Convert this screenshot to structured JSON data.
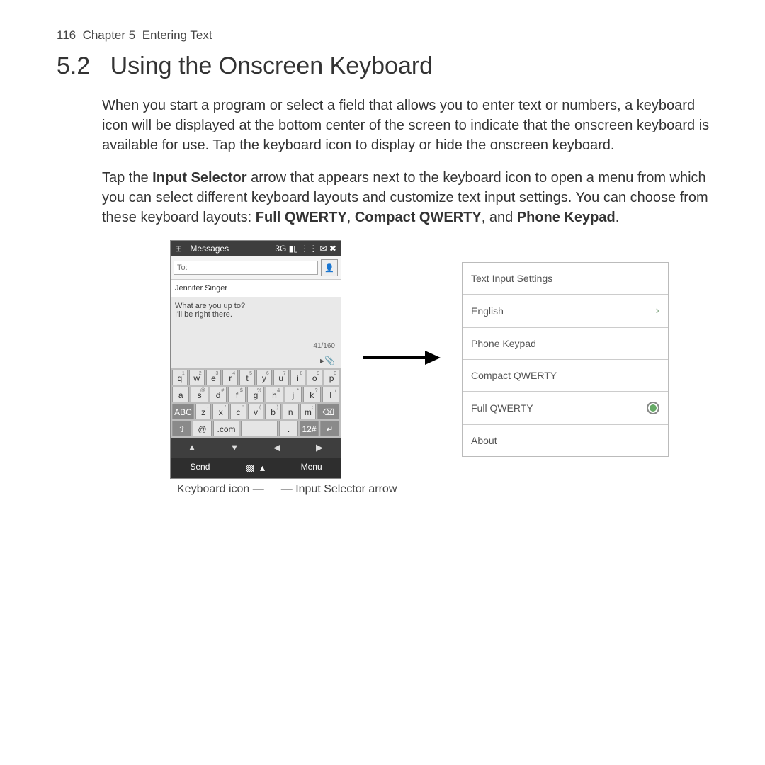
{
  "header": {
    "page_number": "116",
    "chapter": "Chapter 5",
    "chapter_title": "Entering Text"
  },
  "section": {
    "number": "5.2",
    "title": "Using the Onscreen Keyboard"
  },
  "paragraphs": {
    "p1": "When you start a program or select a field that allows you to enter text or numbers, a keyboard icon will be displayed at the bottom center of the screen to indicate that the onscreen keyboard is available for use. Tap the keyboard icon to display or hide the onscreen keyboard.",
    "p2a": "Tap the ",
    "p2b": "Input Selector",
    "p2c": " arrow that appears next to the keyboard icon to open a menu from which you can select different keyboard layouts and customize text input settings. You can choose from these keyboard layouts: ",
    "p2d": "Full QWERTY",
    "p2e": ", ",
    "p2f": "Compact QWERTY",
    "p2g": ", and ",
    "p2h": "Phone Keypad",
    "p2i": "."
  },
  "phone": {
    "app_title": "Messages",
    "status_icons": "3G ▮▯ ⋮⋮ ✉ ✖",
    "to_placeholder": "To:",
    "contact_name": "Jennifer Singer",
    "message_text": "What are you up to?\nI'll be right there.",
    "counter": "41/160",
    "keyboard": {
      "row1": [
        {
          "main": "q",
          "sup": "1"
        },
        {
          "main": "w",
          "sup": "2"
        },
        {
          "main": "e",
          "sup": "3"
        },
        {
          "main": "r",
          "sup": "4"
        },
        {
          "main": "t",
          "sup": "5"
        },
        {
          "main": "y",
          "sup": "6"
        },
        {
          "main": "u",
          "sup": "7"
        },
        {
          "main": "i",
          "sup": "8"
        },
        {
          "main": "o",
          "sup": "9"
        },
        {
          "main": "p",
          "sup": "0"
        }
      ],
      "row2": [
        {
          "main": "a",
          "sup": "!"
        },
        {
          "main": "s",
          "sup": "@"
        },
        {
          "main": "d",
          "sup": "#"
        },
        {
          "main": "f",
          "sup": "$"
        },
        {
          "main": "g",
          "sup": "%"
        },
        {
          "main": "h",
          "sup": "&"
        },
        {
          "main": "j",
          "sup": "*"
        },
        {
          "main": "k",
          "sup": "?"
        },
        {
          "main": "l",
          "sup": "/"
        }
      ],
      "row3_left": "ABC",
      "row3": [
        {
          "main": "z",
          "sup": "-"
        },
        {
          "main": "x",
          "sup": "'"
        },
        {
          "main": "c",
          "sup": "\""
        },
        {
          "main": "v",
          "sup": "("
        },
        {
          "main": "b",
          "sup": ")"
        },
        {
          "main": "n",
          "sup": ";"
        },
        {
          "main": "m",
          "sup": ":"
        }
      ],
      "row3_right": "⌫",
      "row4": {
        "shift": "⇧",
        "at": "@",
        "com": ".com",
        "space": "",
        "dot": ".",
        "num": "12#",
        "enter": "↵"
      }
    },
    "softkeys": {
      "left": "Send",
      "center": "▩ ▴",
      "right": "Menu"
    }
  },
  "settings_menu": {
    "title": "Text Input Settings",
    "items": [
      {
        "label": "English",
        "accessory": "chevron"
      },
      {
        "label": "Phone Keypad",
        "accessory": "none"
      },
      {
        "label": "Compact QWERTY",
        "accessory": "none"
      },
      {
        "label": "Full QWERTY",
        "accessory": "radio-on"
      },
      {
        "label": "About",
        "accessory": "none"
      }
    ]
  },
  "callouts": {
    "keyboard_icon": "Keyboard icon",
    "input_selector": "Input Selector arrow"
  }
}
